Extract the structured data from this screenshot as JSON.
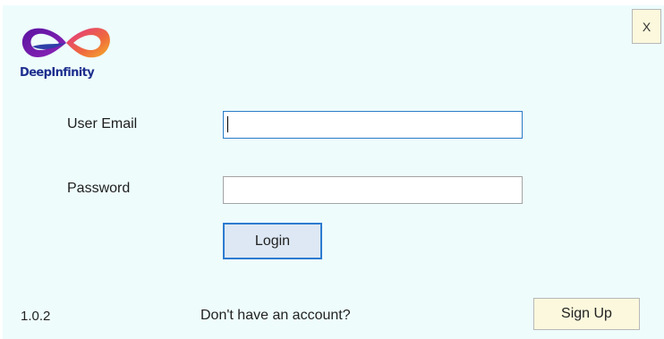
{
  "brand": {
    "name": "DeepInfinity",
    "logo_icon": "infinity-logo-icon",
    "colors": {
      "logo_purple": "#6a1aa8",
      "logo_pink": "#e0338a",
      "logo_orange": "#f2a32a",
      "logo_text": "#1e2f8e"
    }
  },
  "window": {
    "close_label": "X",
    "background": "#eefcfc"
  },
  "form": {
    "email_label": "User Email",
    "email_value": "",
    "password_label": "Password",
    "password_value": "",
    "login_label": "Login"
  },
  "footer": {
    "version": "1.0.2",
    "signup_prompt": "Don't have an account?",
    "signup_label": "Sign Up"
  }
}
